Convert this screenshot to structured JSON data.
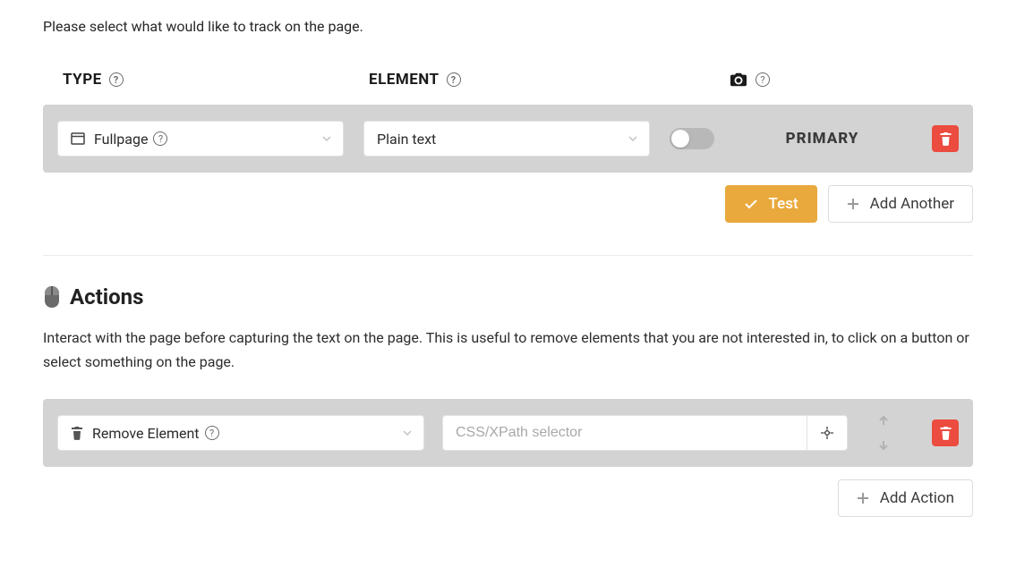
{
  "intro": "Please select what would like to track on the page.",
  "columns": {
    "type": "TYPE",
    "element": "ELEMENT"
  },
  "track_row": {
    "type_value": "Fullpage",
    "element_value": "Plain text",
    "primary_label": "PRIMARY"
  },
  "buttons": {
    "test": "Test",
    "add_another": "Add Another",
    "add_action": "Add Action"
  },
  "actions": {
    "heading": "Actions",
    "description": "Interact with the page before capturing the text on the page. This is useful to remove elements that you are not interested in, to click on a button or select something on the page.",
    "row": {
      "action_value": "Remove Element",
      "selector_placeholder": "CSS/XPath selector"
    }
  }
}
